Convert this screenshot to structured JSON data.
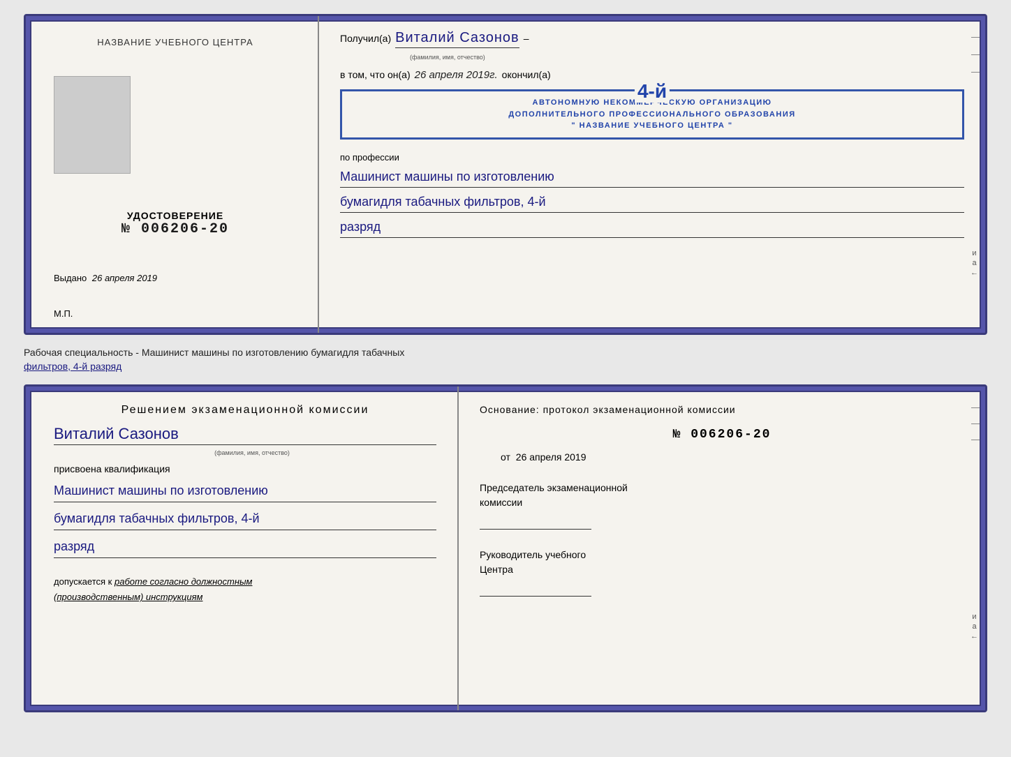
{
  "top_doc": {
    "left": {
      "training_center_label": "НАЗВАНИЕ УЧЕБНОГО ЦЕНТРА",
      "section_title": "УДОСТОВЕРЕНИЕ",
      "number_prefix": "№",
      "number": "006206-20",
      "vydano_label": "Выдано",
      "vydano_date": "26 апреля 2019",
      "mp_label": "М.П."
    },
    "right": {
      "poluchil_label": "Получил(а)",
      "name_handwritten": "Виталий Сазонов",
      "name_hint": "(фамилия, имя, отчество)",
      "dash": "–",
      "vtom_label": "в том, что он(а)",
      "vtom_date": "26 апреля 2019г.",
      "okonchil_label": "окончил(а)",
      "stamp_number": "4-й",
      "stamp_line1": "АВТОНОМНУЮ НЕКОММЕРЧЕСКУЮ ОРГАНИЗАЦИЮ",
      "stamp_line2": "ДОПОЛНИТЕЛЬНОГО ПРОФЕССИОНАЛЬНОГО ОБРАЗОВАНИЯ",
      "stamp_line3": "\" НАЗВАНИЕ УЧЕБНОГО ЦЕНТРА \"",
      "i_label": "и",
      "a_label": "а",
      "arrow_label": "←",
      "po_professii_label": "по профессии",
      "profession_line1": "Машинист машины по изготовлению",
      "profession_line2": "бумагидля табачных фильтров, 4-й",
      "profession_line3": "разряд"
    }
  },
  "doc_label": {
    "text": "Рабочая специальность - Машинист машины по изготовлению бумагидля табачных",
    "underline_text": "фильтров, 4-й разряд"
  },
  "bottom_doc": {
    "left": {
      "resheniem_title": "Решением экзаменационной комиссии",
      "name_handwritten": "Виталий Сазонов",
      "name_hint": "(фамилия, имя, отчество)",
      "prisvoena_text": "присвоена квалификация",
      "profession_line1": "Машинист машины по изготовлению",
      "profession_line2": "бумагидля табачных фильтров, 4-й",
      "profession_line3": "разряд",
      "dopuskaetsya_label": "допускается к",
      "dopuskaetsya_text": "работе согласно должностным",
      "dopuskaetsya_text2": "(производственным) инструкциям"
    },
    "right": {
      "osnovanie_label": "Основание: протокол экзаменационной комиссии",
      "number_prefix": "№",
      "number": "006206-20",
      "ot_prefix": "от",
      "ot_date": "26 апреля 2019",
      "predsedatel_line1": "Председатель экзаменационной",
      "predsedatel_line2": "комиссии",
      "rukovoditel_line1": "Руководитель учебного",
      "rukovoditel_line2": "Центра",
      "i_label": "и",
      "a_label": "а",
      "arrow_label": "←"
    }
  }
}
